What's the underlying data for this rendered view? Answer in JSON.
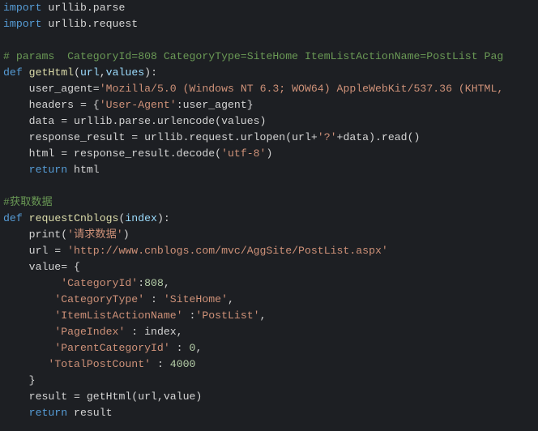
{
  "code": {
    "l01_import": "import",
    "l01_mod": " urllib.parse",
    "l02_import": "import",
    "l02_mod": " urllib.request",
    "l03": "",
    "l04_cmt": "# params  CategoryId=808 CategoryType=SiteHome ItemListActionName=PostList Pag",
    "l05_def": "def",
    "l05_sp1": " ",
    "l05_fn": "getHtml",
    "l05_p_open": "(",
    "l05_param1": "url",
    "l05_comma": ",",
    "l05_param2": "values",
    "l05_p_close": ")",
    "l05_colon": ":",
    "l06_ind": "    ",
    "l06_a": "user_agent=",
    "l06_str": "'Mozilla/5.0 (Windows NT 6.3; WOW64) AppleWebKit/537.36 (KHTML,",
    "l07_ind": "    ",
    "l07_a": "headers = {",
    "l07_str": "'User-Agent'",
    "l07_b": ":user_agent}",
    "l08_ind": "    ",
    "l08_a": "data = urllib.parse.urlencode(values)",
    "l09_ind": "    ",
    "l09_a": "response_result = urllib.request.urlopen(url+",
    "l09_str": "'?'",
    "l09_b": "+data).read()",
    "l10_ind": "    ",
    "l10_a": "html = response_result.decode(",
    "l10_str": "'utf-8'",
    "l10_b": ")",
    "l11_ind": "    ",
    "l11_ret": "return",
    "l11_b": " html",
    "l12": "",
    "l13_cmt": "#获取数据",
    "l14_def": "def",
    "l14_sp1": " ",
    "l14_fn": "requestCnblogs",
    "l14_p_open": "(",
    "l14_param1": "index",
    "l14_p_close": ")",
    "l14_colon": ":",
    "l15_ind": "    ",
    "l15_a": "print(",
    "l15_str": "'请求数据'",
    "l15_b": ")",
    "l16_ind": "    ",
    "l16_a": "url = ",
    "l16_str": "'http://www.cnblogs.com/mvc/AggSite/PostList.aspx'",
    "l17_ind": "    ",
    "l17_a": "value= {",
    "l18_ind": "         ",
    "l18_str": "'CategoryId'",
    "l18_b": ":",
    "l18_num": "808",
    "l18_c": ",",
    "l19_ind": "        ",
    "l19_str": "'CategoryType'",
    "l19_b": " : ",
    "l19_str2": "'SiteHome'",
    "l19_c": ",",
    "l20_ind": "        ",
    "l20_str": "'ItemListActionName'",
    "l20_b": " :",
    "l20_str2": "'PostList'",
    "l20_c": ",",
    "l21_ind": "        ",
    "l21_str": "'PageIndex'",
    "l21_b": " : index,",
    "l22_ind": "        ",
    "l22_str": "'ParentCategoryId'",
    "l22_b": " : ",
    "l22_num": "0",
    "l22_c": ",",
    "l23_ind": "       ",
    "l23_str": "'TotalPostCount'",
    "l23_b": " : ",
    "l23_num": "4000",
    "l24_ind": "    ",
    "l24_a": "}",
    "l25_ind": "    ",
    "l25_a": "result = getHtml(url,value)",
    "l26_ind": "    ",
    "l26_ret": "return",
    "l26_b": " result"
  }
}
